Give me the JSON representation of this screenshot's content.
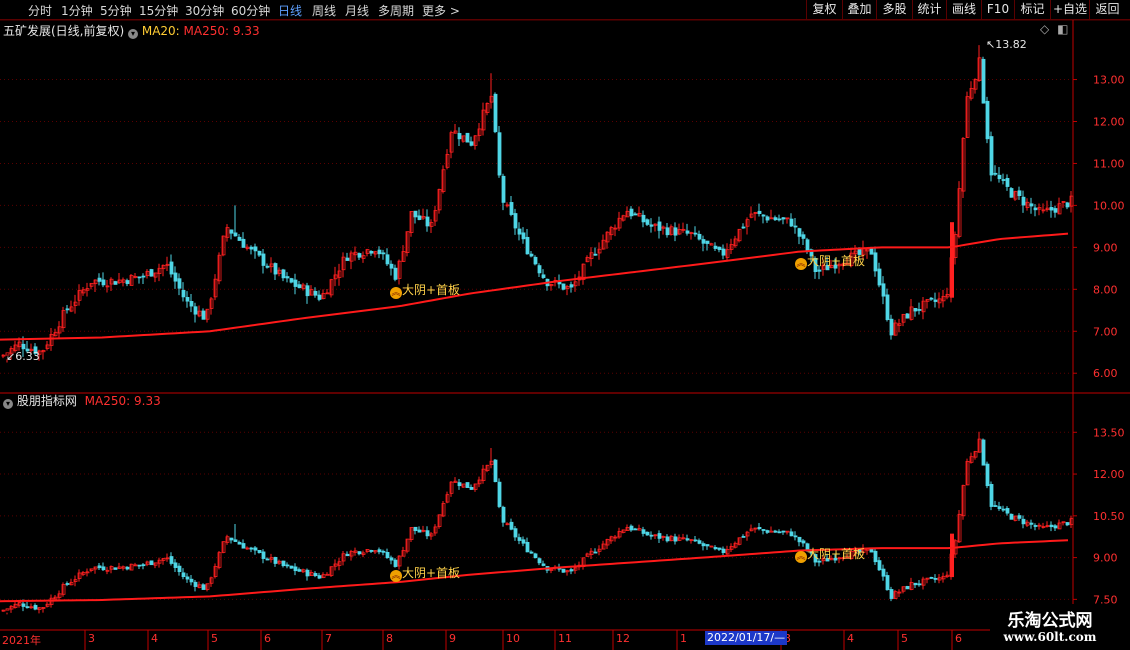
{
  "toolbar": {
    "left": [
      "分时",
      "1分钟",
      "5分钟",
      "15分钟",
      "30分钟",
      "60分钟",
      "日线",
      "周线",
      "月线",
      "多周期",
      "更多"
    ],
    "active": "日线",
    "right": [
      "复权",
      "叠加",
      "多股",
      "统计",
      "画线",
      "F10",
      "标记",
      "+自选",
      "返回"
    ]
  },
  "main_panel": {
    "title": "五矿发展(日线,前复权)",
    "ma20_label": "MA20:",
    "ma250_label": "MA250: 9.33",
    "high_label": "13.82",
    "low_label": "6.33",
    "signal_label": "大阴+首板"
  },
  "sub_panel": {
    "title": "股朋指标网",
    "ma250_label": "MA250: 9.33",
    "signal_label": "大阴+首板"
  },
  "date_axis": {
    "labels": [
      "2021年",
      "3",
      "4",
      "5",
      "6",
      "7",
      "8",
      "9",
      "10",
      "11",
      "12",
      "1",
      "3",
      "4",
      "5",
      "6"
    ],
    "cursor_date": "2022/01/17/—"
  },
  "watermark": {
    "title": "乐淘公式网",
    "url": "www.60lt.com"
  },
  "colors": {
    "up": "#ff2020",
    "down": "#4fd6e6",
    "ma250": "#ff1a1a",
    "grid": "#5a0000",
    "label_yellow": "#ffd24a"
  },
  "chart_data": [
    {
      "type": "candlestick",
      "title": "五矿发展(日线,前复权)",
      "series": [
        {
          "name": "MA250",
          "last_value": 9.33
        }
      ],
      "y_ticks": [
        6.0,
        7.0,
        8.0,
        9.0,
        10.0,
        11.0,
        12.0,
        13.0
      ],
      "ylim": [
        5.6,
        14.3
      ],
      "annotations": [
        {
          "text": "13.82",
          "value": 13.82
        },
        {
          "text": "6.33",
          "value": 6.33
        },
        {
          "text": "大阴+首板"
        },
        {
          "text": "大阴+首板"
        }
      ],
      "price_path": [
        [
          0,
          6.4
        ],
        [
          18,
          6.7
        ],
        [
          40,
          6.5
        ],
        [
          65,
          7.5
        ],
        [
          90,
          8.2
        ],
        [
          115,
          8.2
        ],
        [
          140,
          8.3
        ],
        [
          165,
          8.6
        ],
        [
          185,
          7.7
        ],
        [
          205,
          7.3
        ],
        [
          225,
          9.5
        ],
        [
          250,
          8.9
        ],
        [
          285,
          8.2
        ],
        [
          320,
          7.8
        ],
        [
          345,
          8.8
        ],
        [
          375,
          9.0
        ],
        [
          395,
          8.3
        ],
        [
          410,
          9.8
        ],
        [
          430,
          9.5
        ],
        [
          450,
          11.8
        ],
        [
          470,
          11.5
        ],
        [
          490,
          12.6
        ],
        [
          500,
          10.2
        ],
        [
          520,
          9.2
        ],
        [
          545,
          8.2
        ],
        [
          570,
          8.0
        ],
        [
          590,
          8.8
        ],
        [
          625,
          9.9
        ],
        [
          650,
          9.5
        ],
        [
          690,
          9.3
        ],
        [
          720,
          8.8
        ],
        [
          750,
          9.8
        ],
        [
          790,
          9.6
        ],
        [
          805,
          9.0
        ],
        [
          815,
          8.4
        ],
        [
          840,
          8.7
        ],
        [
          870,
          8.9
        ],
        [
          890,
          7.0
        ],
        [
          910,
          7.5
        ],
        [
          945,
          7.8
        ],
        [
          955,
          9.5
        ],
        [
          965,
          12.5
        ],
        [
          978,
          13.4
        ],
        [
          990,
          10.8
        ],
        [
          1010,
          10.3
        ],
        [
          1040,
          9.8
        ],
        [
          1070,
          10.1
        ]
      ],
      "ma250_path": [
        [
          0,
          6.8
        ],
        [
          100,
          6.85
        ],
        [
          210,
          7.0
        ],
        [
          300,
          7.3
        ],
        [
          400,
          7.6
        ],
        [
          470,
          7.9
        ],
        [
          560,
          8.2
        ],
        [
          700,
          8.6
        ],
        [
          800,
          8.9
        ],
        [
          880,
          9.0
        ],
        [
          950,
          9.0
        ],
        [
          1000,
          9.2
        ],
        [
          1070,
          9.33
        ]
      ]
    },
    {
      "type": "candlestick",
      "title": "股朋指标网",
      "series": [
        {
          "name": "MA250",
          "last_value": 9.33
        }
      ],
      "y_ticks": [
        7.5,
        9.0,
        10.5,
        12.0,
        13.5
      ],
      "ylim": [
        6.4,
        14.3
      ],
      "annotations": [
        {
          "text": "大阴+首板"
        },
        {
          "text": "大阴+首板"
        }
      ]
    }
  ]
}
